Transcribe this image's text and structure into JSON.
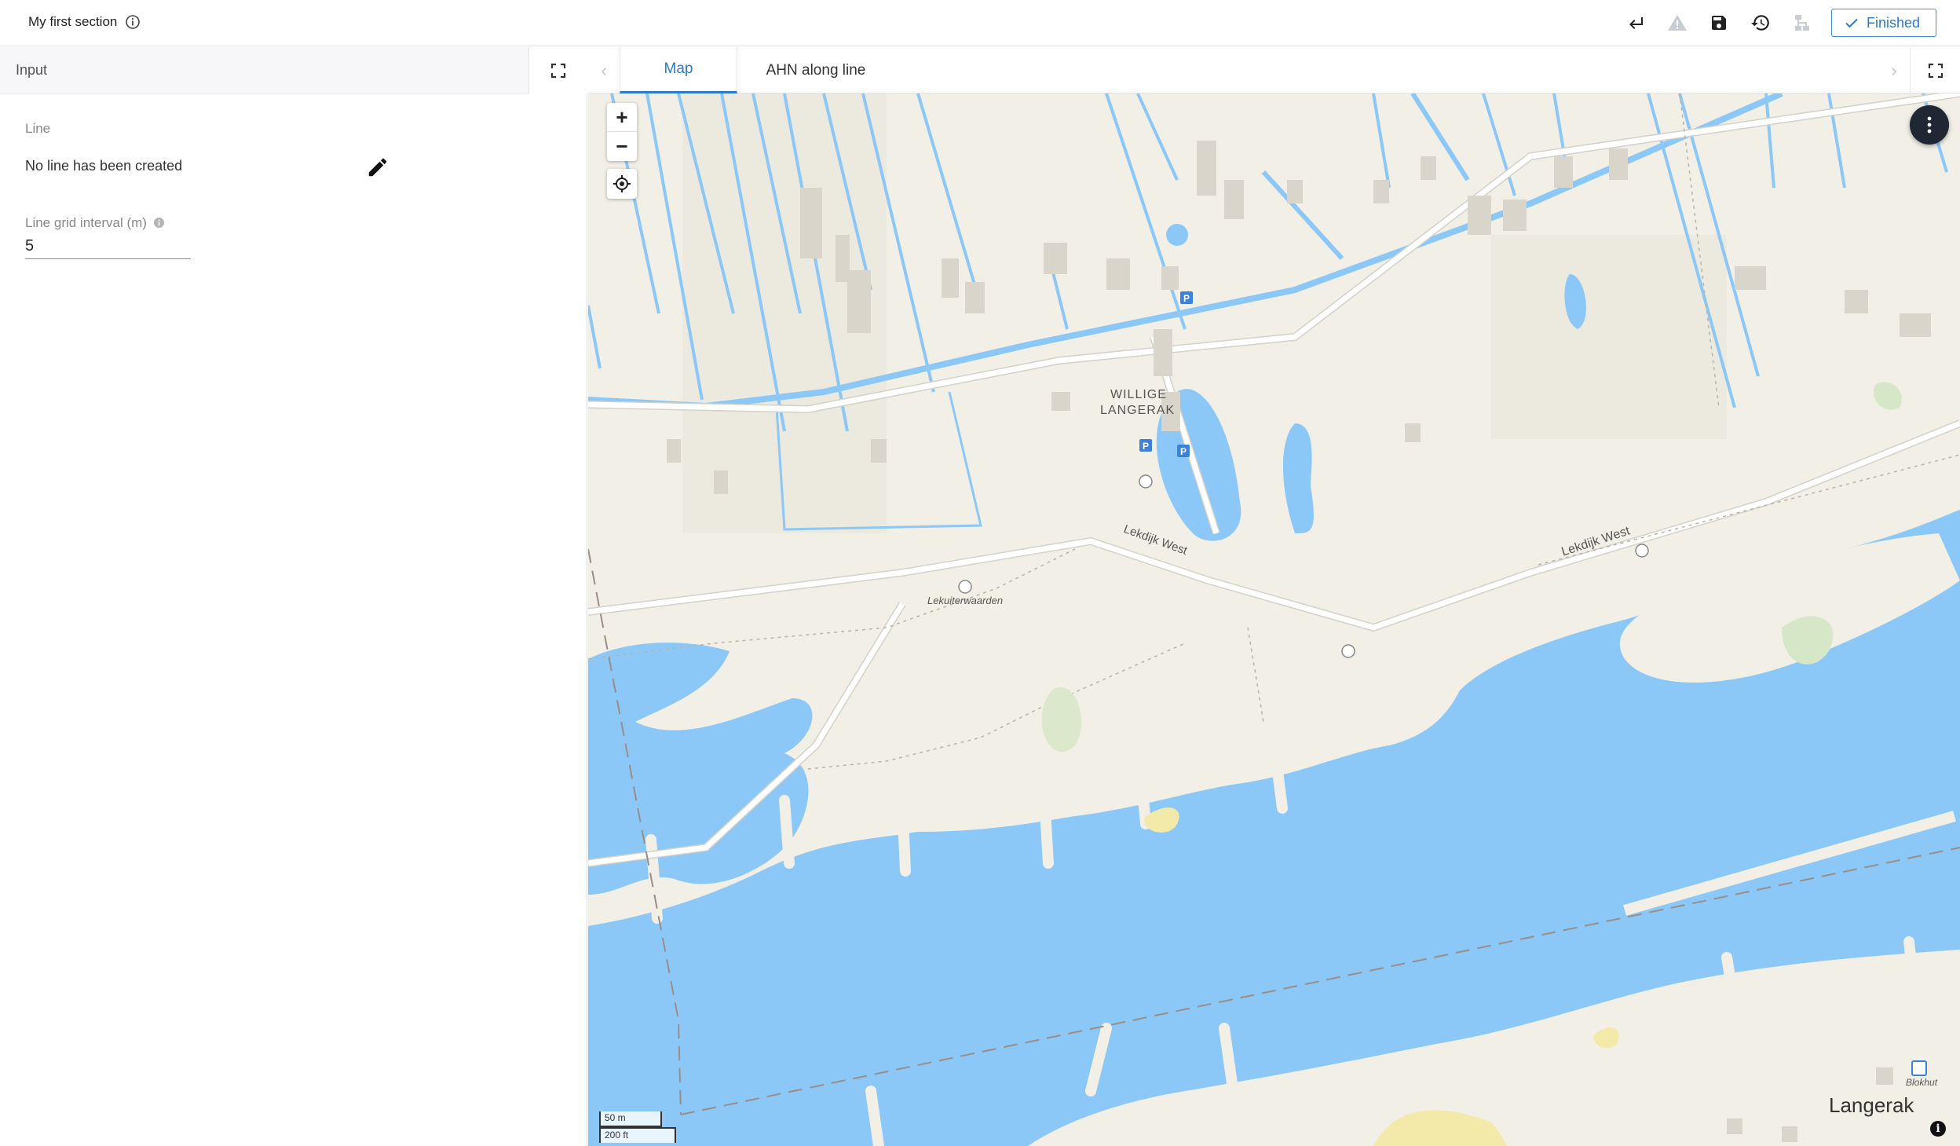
{
  "header": {
    "title": "My first section",
    "finished_label": "Finished"
  },
  "left_panel": {
    "heading": "Input",
    "line_caption": "Line",
    "line_value": "No line has been created",
    "grid_caption": "Line grid interval (m)",
    "grid_value": "5"
  },
  "tabs": [
    {
      "label": "Map",
      "active": true
    },
    {
      "label": "AHN along line",
      "active": false
    }
  ],
  "map": {
    "zoom_in": "+",
    "zoom_out": "−",
    "labels": {
      "village_line1": "WILLIGE",
      "village_line2": "LANGERAK",
      "road1": "Lekdijk West",
      "road2": "Lekdijk West",
      "poi": "Lekuiterwaarden",
      "blokhut": "Blokhut",
      "town": "Langerak"
    },
    "scale_metric": "50 m",
    "scale_imperial": "200 ft",
    "attribution": "i",
    "colors": {
      "water": "#8bc8f7",
      "land": "#f1efe6",
      "road": "#ffffff",
      "accent": "#2a7bc8"
    }
  }
}
